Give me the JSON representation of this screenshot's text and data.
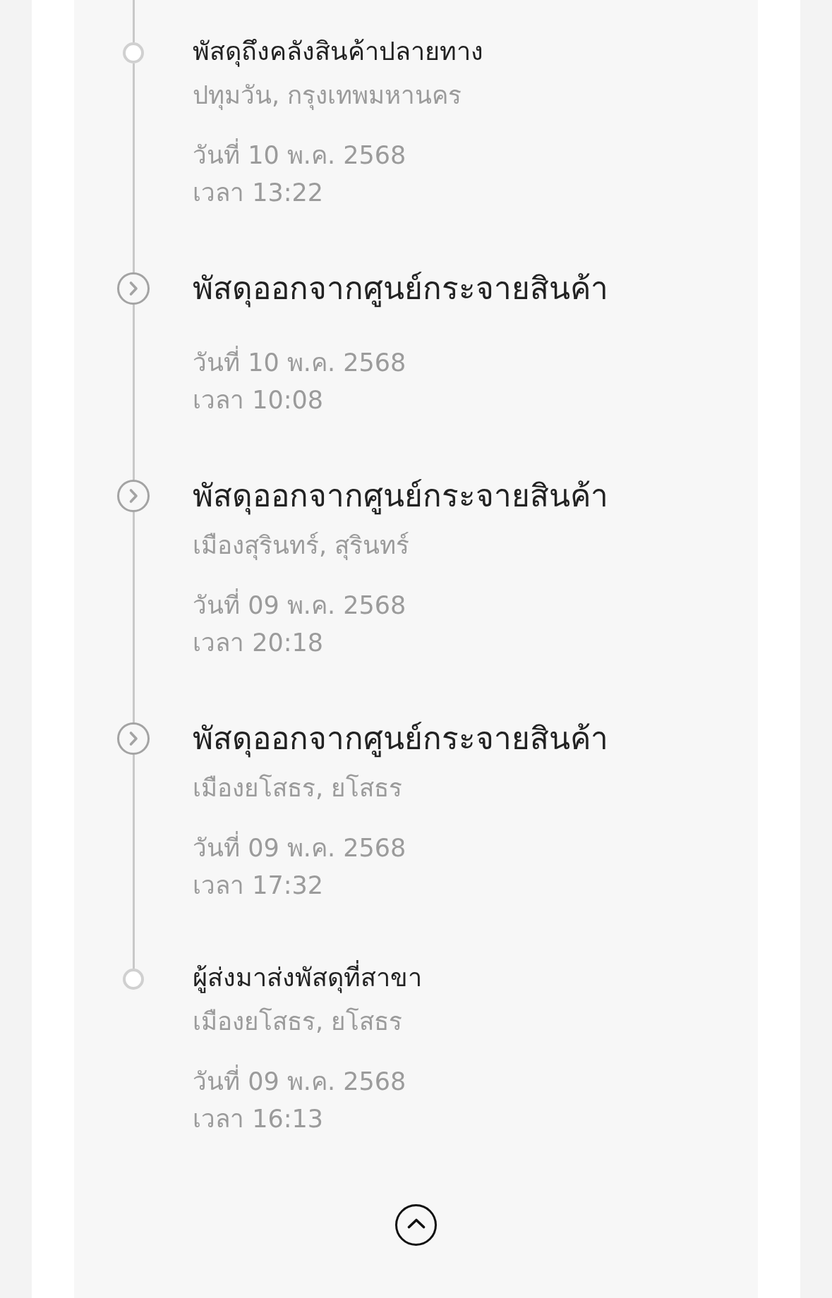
{
  "timeline": {
    "events": [
      {
        "kind": "checkpoint",
        "title": "พัสดุถึงคลังสินค้าปลายทาง",
        "location": "ปทุมวัน, กรุงเทพมหานคร",
        "date": "วันที่ 10 พ.ค. 2568",
        "time": "เวลา 13:22"
      },
      {
        "kind": "transit",
        "title": "พัสดุออกจากศูนย์กระจายสินค้า",
        "date": "วันที่ 10 พ.ค. 2568",
        "time": "เวลา 10:08"
      },
      {
        "kind": "transit",
        "title": "พัสดุออกจากศูนย์กระจายสินค้า",
        "location": "เมืองสุรินทร์, สุรินทร์",
        "date": "วันที่ 09 พ.ค. 2568",
        "time": "เวลา 20:18"
      },
      {
        "kind": "transit",
        "title": "พัสดุออกจากศูนย์กระจายสินค้า",
        "location": "เมืองยโสธร, ยโสธร",
        "date": "วันที่ 09 พ.ค. 2568",
        "time": "เวลา 17:32"
      },
      {
        "kind": "checkpoint",
        "title": "ผู้ส่งมาส่งพัสดุที่สาขา",
        "location": "เมืองยโสธร, ยโสธร",
        "date": "วันที่ 09 พ.ค. 2568",
        "time": "เวลา 16:13"
      }
    ]
  }
}
